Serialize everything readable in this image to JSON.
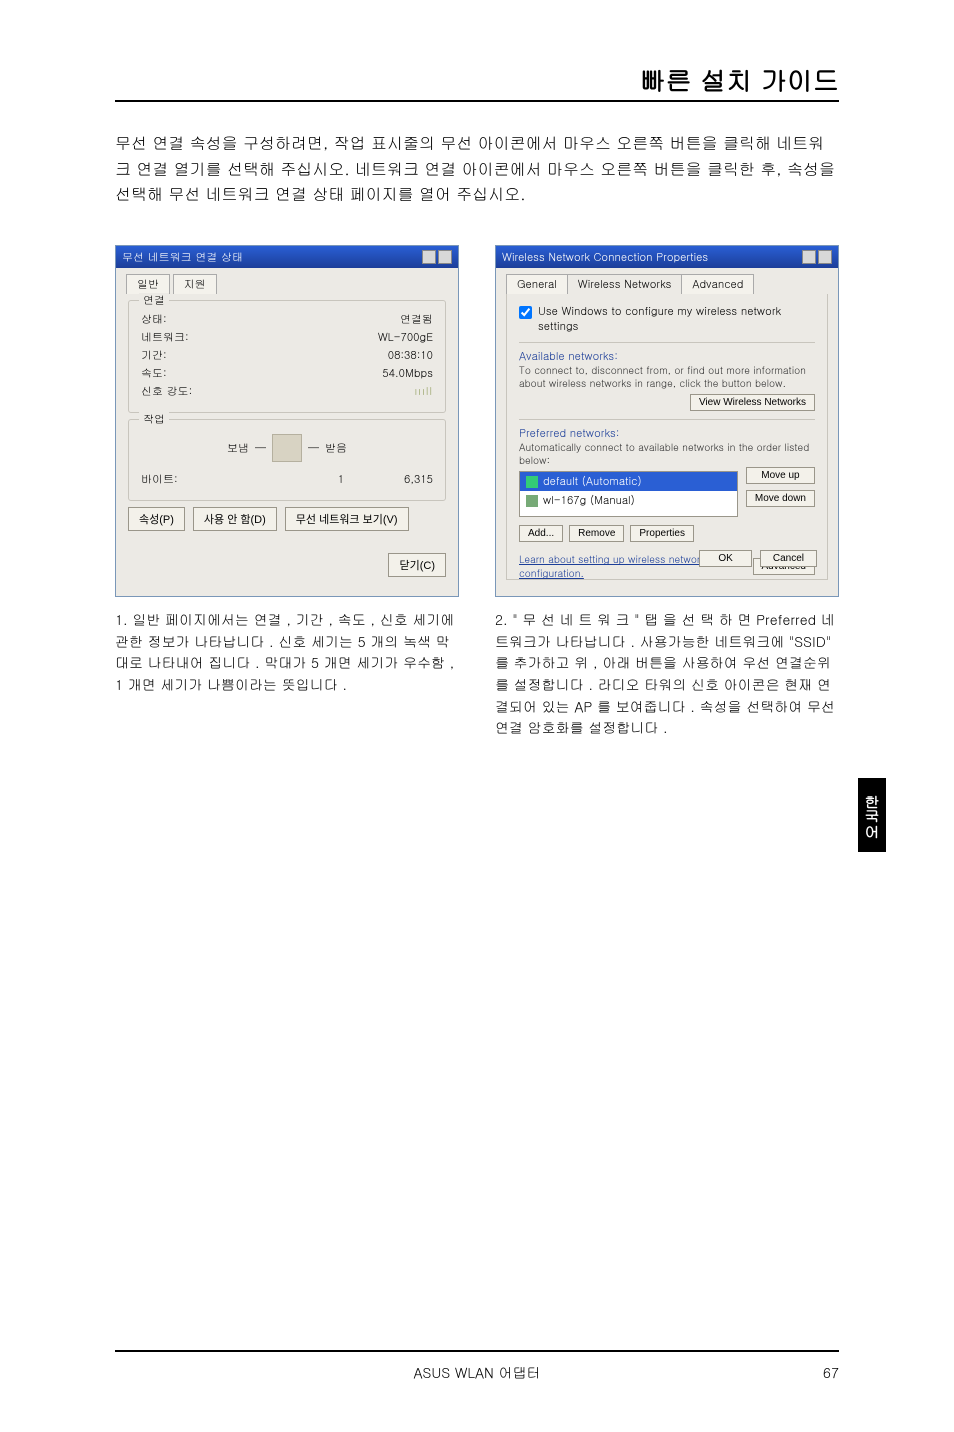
{
  "page_title": "빠른 설치 가이드",
  "intro": "무선 연결 속성을 구성하려면, 작업 표시줄의 무선 아이콘에서 마우스 오른쪽 버튼을 클릭해 네트워크 연결 열기를 선택해 주십시오. 네트워크 연결 아이콘에서 마우스 오른쪽 버튼을 클릭한 후, 속성을 선택해 무선 네트워크 연결 상태 페이지를 열어 주십시오.",
  "left_dialog": {
    "title": "무선 네트워크 연결 상태",
    "tabs": [
      "일반",
      "지원"
    ],
    "group1_title": "연결",
    "rows1": [
      {
        "l": "상태:",
        "r": "연결됨"
      },
      {
        "l": "네트워크:",
        "r": "WL-700gE"
      },
      {
        "l": "기간:",
        "r": "08:38:10"
      },
      {
        "l": "속도:",
        "r": "54.0Mbps"
      },
      {
        "l": "신호 강도:",
        "r": "ıııll"
      }
    ],
    "group2_title": "작업",
    "sent": "보냄",
    "recv": "받음",
    "bytes_l": "바이트:",
    "bytes_sent": "1",
    "bytes_recv": "6,315",
    "btn_props": "속성(P)",
    "btn_disable": "사용 안 함(D)",
    "btn_view": "무선 네트워크 보기(V)",
    "btn_close": "닫기(C)"
  },
  "right_dialog": {
    "title": "Wireless Network Connection Properties",
    "tabs": [
      "General",
      "Wireless Networks",
      "Advanced"
    ],
    "checkbox": "Use Windows to configure my wireless network settings",
    "avail_h": "Available networks:",
    "avail_txt": "To connect to, disconnect from, or find out more information about wireless networks in range, click the button below.",
    "btn_view": "View Wireless Networks",
    "pref_h": "Preferred networks:",
    "pref_txt": "Automatically connect to available networks in the order listed below:",
    "items": [
      {
        "label": "default (Automatic)",
        "sel": true
      },
      {
        "label": "wl-167g (Manual)",
        "sel": false
      }
    ],
    "btn_up": "Move up",
    "btn_down": "Move down",
    "btn_add": "Add...",
    "btn_remove": "Remove",
    "btn_props": "Properties",
    "learn": "Learn about setting up wireless network configuration.",
    "btn_adv": "Advanced",
    "btn_ok": "OK",
    "btn_cancel": "Cancel"
  },
  "caption_left": "1. 일반 페이지에서는 연결 , 기간 , 속도 , 신호 세기에 관한 정보가 나타납니다 . 신호 세기는 5 개의 녹색 막대로 나타내어 집니다 . 막대가 5 개면 세기가 우수함 , 1 개면 세기가 나쁨이라는 뜻입니다 .",
  "caption_right": "2. \" 무 선 네 트 워 크 \" 탭 을 선 택 하 면 Preferred 네트워크가 나타납니다 . 사용가능한 네트워크에 \"SSID\" 를 추가하고 위 , 아래 버튼을 사용하여 우선 연결순위를 설정합니다 . 라디오 타워의 신호 아이콘은 현재 연결되어 있는 AP 를 보여줍니다 . 속성을 선택하여 무선 연결 암호화를 설정합니다 .",
  "sidetab": "한국어",
  "footer_center": "ASUS WLAN 어댑터",
  "footer_page": "67"
}
